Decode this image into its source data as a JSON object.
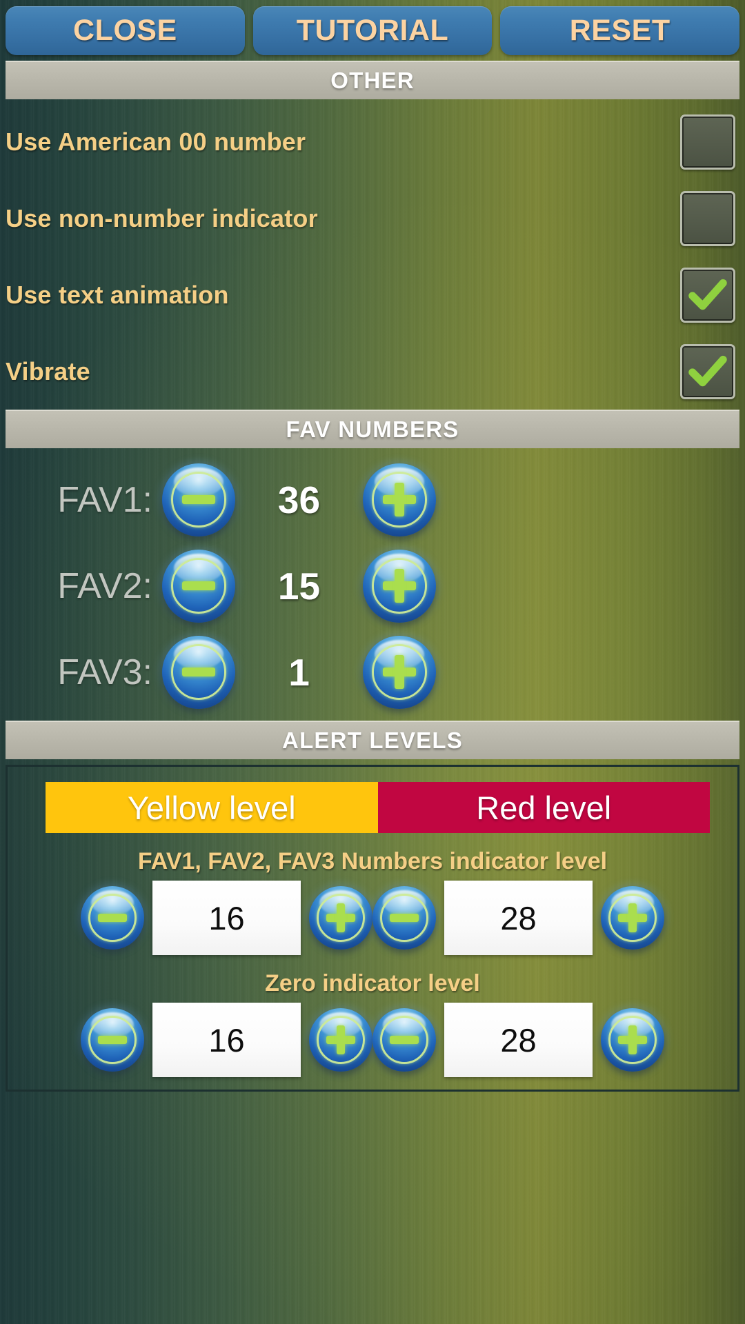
{
  "topbar": {
    "buttons": [
      {
        "label": "CLOSE",
        "name": "close-button"
      },
      {
        "label": "TUTORIAL",
        "name": "tutorial-button"
      },
      {
        "label": "RESET",
        "name": "reset-button"
      }
    ]
  },
  "other_section": {
    "header": "OTHER",
    "rows": [
      {
        "label": "Use American 00 number",
        "checked": false
      },
      {
        "label": "Use non-number indicator",
        "checked": false
      },
      {
        "label": "Use text animation",
        "checked": true
      },
      {
        "label": "Vibrate",
        "checked": true
      }
    ]
  },
  "fav_section": {
    "header": "FAV NUMBERS",
    "rows": [
      {
        "label": "FAV1:",
        "value": "36",
        "minus": "minus-icon",
        "plus": "plus-icon"
      },
      {
        "label": "FAV2:",
        "value": "15",
        "minus": "minus-icon",
        "plus": "plus-icon"
      },
      {
        "label": "FAV3:",
        "value": "1",
        "minus": "minus-icon",
        "plus": "plus-icon"
      }
    ]
  },
  "alert_section": {
    "header": "ALERT LEVELS",
    "tabs": [
      {
        "label": "Yellow level",
        "color": "#ffc50d"
      },
      {
        "label": "Red level",
        "color": "#c10641"
      }
    ],
    "groups": [
      {
        "title": "FAV1, FAV2, FAV3 Numbers indicator level",
        "yellow_value": "16",
        "red_value": "28"
      },
      {
        "title": "Zero indicator level",
        "yellow_value": "16",
        "red_value": "28"
      }
    ]
  },
  "colors": {
    "accent_text": "#f5cf86",
    "button_text": "#fcd3a2",
    "button_blue": "#3f7cb0",
    "header_bar": "#b7b5a9",
    "check_green": "#8fd13f",
    "yellow_level": "#ffc50d",
    "red_level": "#c10641"
  }
}
